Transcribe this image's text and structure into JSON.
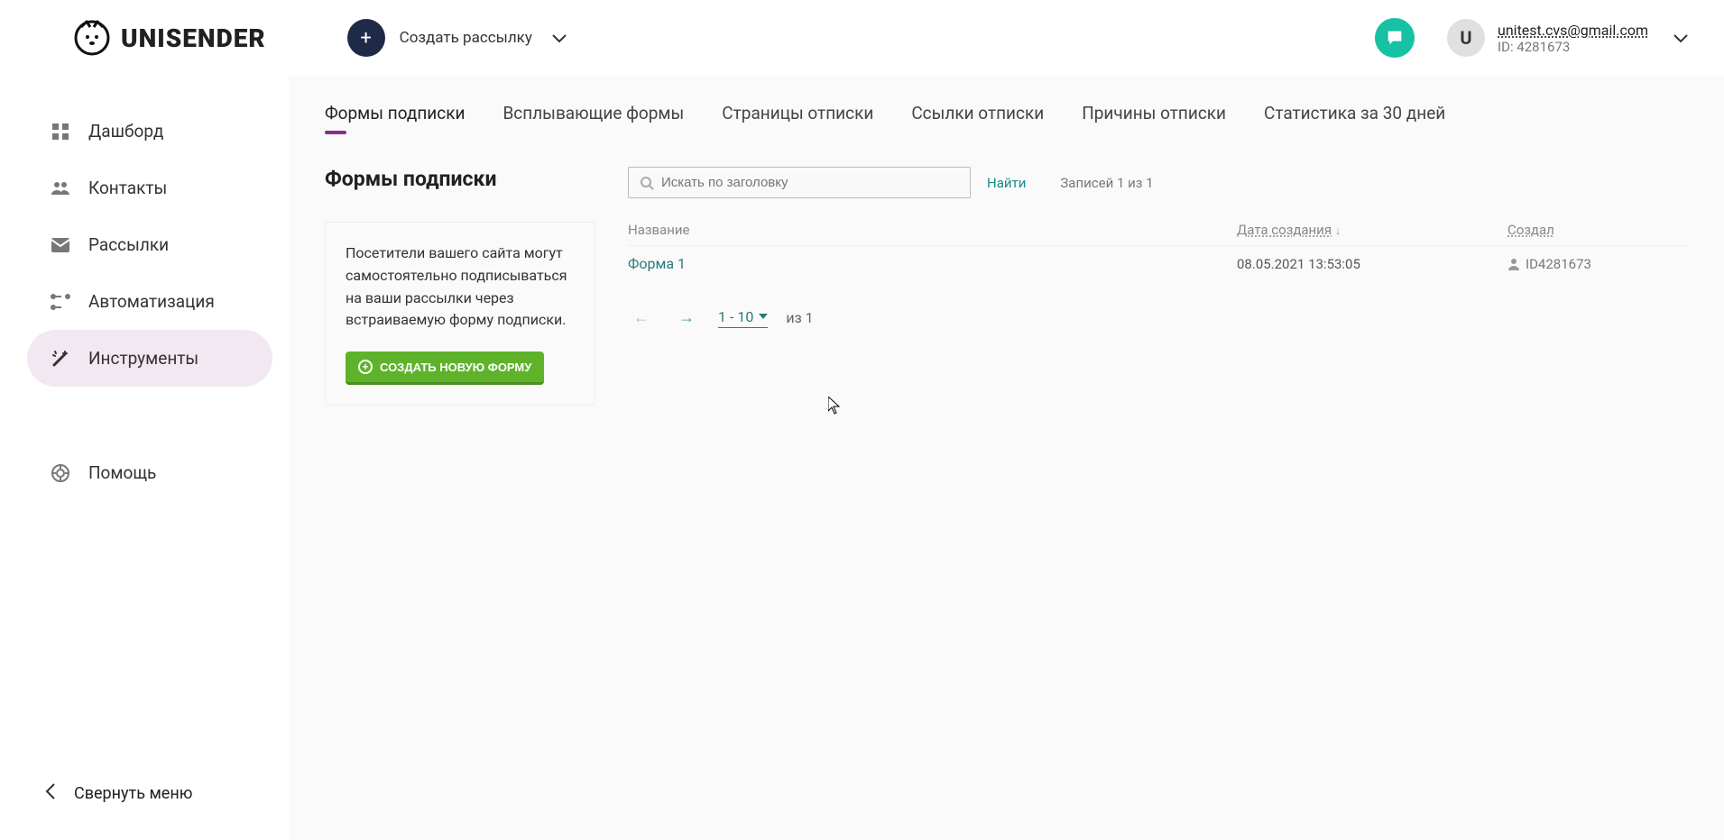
{
  "brand": "UNISENDER",
  "header": {
    "create_label": "Создать рассылку",
    "user_email": "unitest.cvs@gmail.com",
    "user_id_label": "ID: 4281673",
    "avatar_letter": "U"
  },
  "sidebar": {
    "items": [
      {
        "key": "dashboard",
        "label": "Дашборд"
      },
      {
        "key": "contacts",
        "label": "Контакты"
      },
      {
        "key": "campaigns",
        "label": "Рассылки"
      },
      {
        "key": "automation",
        "label": "Автоматизация"
      },
      {
        "key": "tools",
        "label": "Инструменты"
      }
    ],
    "help_label": "Помощь",
    "collapse_label": "Свернуть меню"
  },
  "tabs": [
    "Формы подписки",
    "Всплывающие формы",
    "Страницы отписки",
    "Ссылки отписки",
    "Причины отписки",
    "Статистика за 30 дней"
  ],
  "page": {
    "title": "Формы подписки",
    "description": "Посетители вашего сайта могут самостоятельно подписываться на ваши рассылки через встраиваемую форму подписки.",
    "create_button": "СОЗДАТЬ НОВУЮ ФОРМУ"
  },
  "search": {
    "placeholder": "Искать по заголовку",
    "find_label": "Найти",
    "records_label": "Записей 1 из 1"
  },
  "table": {
    "headers": {
      "name": "Название",
      "created": "Дата создания",
      "author": "Создал"
    },
    "rows": [
      {
        "name": "Форма 1",
        "created": "08.05.2021 13:53:05",
        "author": "ID4281673"
      }
    ]
  },
  "pager": {
    "range": "1 - 10",
    "total": "из 1"
  }
}
